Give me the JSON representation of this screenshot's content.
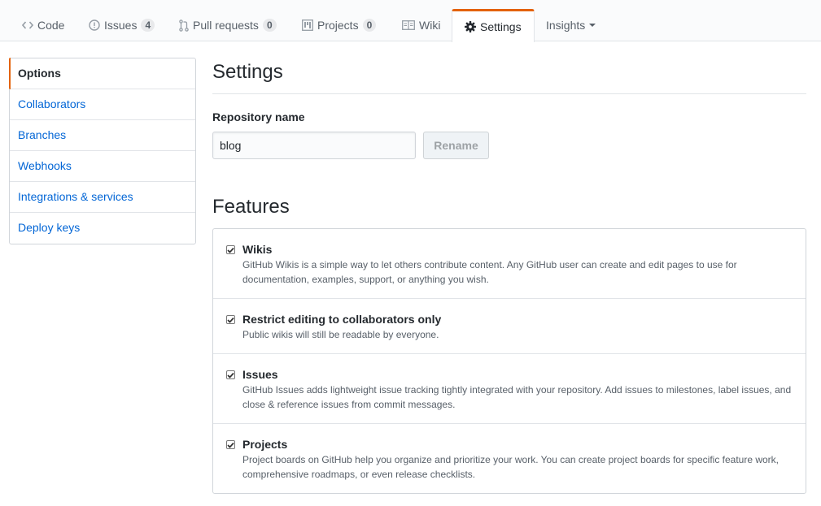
{
  "tabs": [
    {
      "label": "Code",
      "icon": "code-icon"
    },
    {
      "label": "Issues",
      "icon": "issue-opened-icon",
      "count": "4"
    },
    {
      "label": "Pull requests",
      "icon": "git-pull-request-icon",
      "count": "0"
    },
    {
      "label": "Projects",
      "icon": "project-icon",
      "count": "0"
    },
    {
      "label": "Wiki",
      "icon": "book-icon"
    },
    {
      "label": "Settings",
      "icon": "gear-icon",
      "selected": true
    },
    {
      "label": "Insights",
      "icon": "triangle-down-icon"
    }
  ],
  "menu": {
    "items": [
      {
        "label": "Options",
        "selected": true
      },
      {
        "label": "Collaborators"
      },
      {
        "label": "Branches"
      },
      {
        "label": "Webhooks"
      },
      {
        "label": "Integrations & services"
      },
      {
        "label": "Deploy keys"
      }
    ]
  },
  "main": {
    "title": "Settings",
    "repo_name_label": "Repository name",
    "repo_name_value": "blog",
    "rename_button": "Rename",
    "features_title": "Features",
    "features": [
      {
        "title": "Wikis",
        "checked": true,
        "description": "GitHub Wikis is a simple way to let others contribute content. Any GitHub user can create and edit pages to use for documentation, examples, support, or anything you wish."
      },
      {
        "title": "Restrict editing to collaborators only",
        "checked": true,
        "description": "Public wikis will still be readable by everyone."
      },
      {
        "title": "Issues",
        "checked": true,
        "description": "GitHub Issues adds lightweight issue tracking tightly integrated with your repository. Add issues to milestones, label issues, and close & reference issues from commit messages."
      },
      {
        "title": "Projects",
        "checked": true,
        "description": "Project boards on GitHub help you organize and prioritize your work. You can create project boards for specific feature work, comprehensive roadmaps, or even release checklists."
      }
    ]
  },
  "colors": {
    "accent": "#e36209",
    "link": "#0366d6",
    "text": "#24292e",
    "muted": "#586069",
    "border": "#d1d5da"
  }
}
